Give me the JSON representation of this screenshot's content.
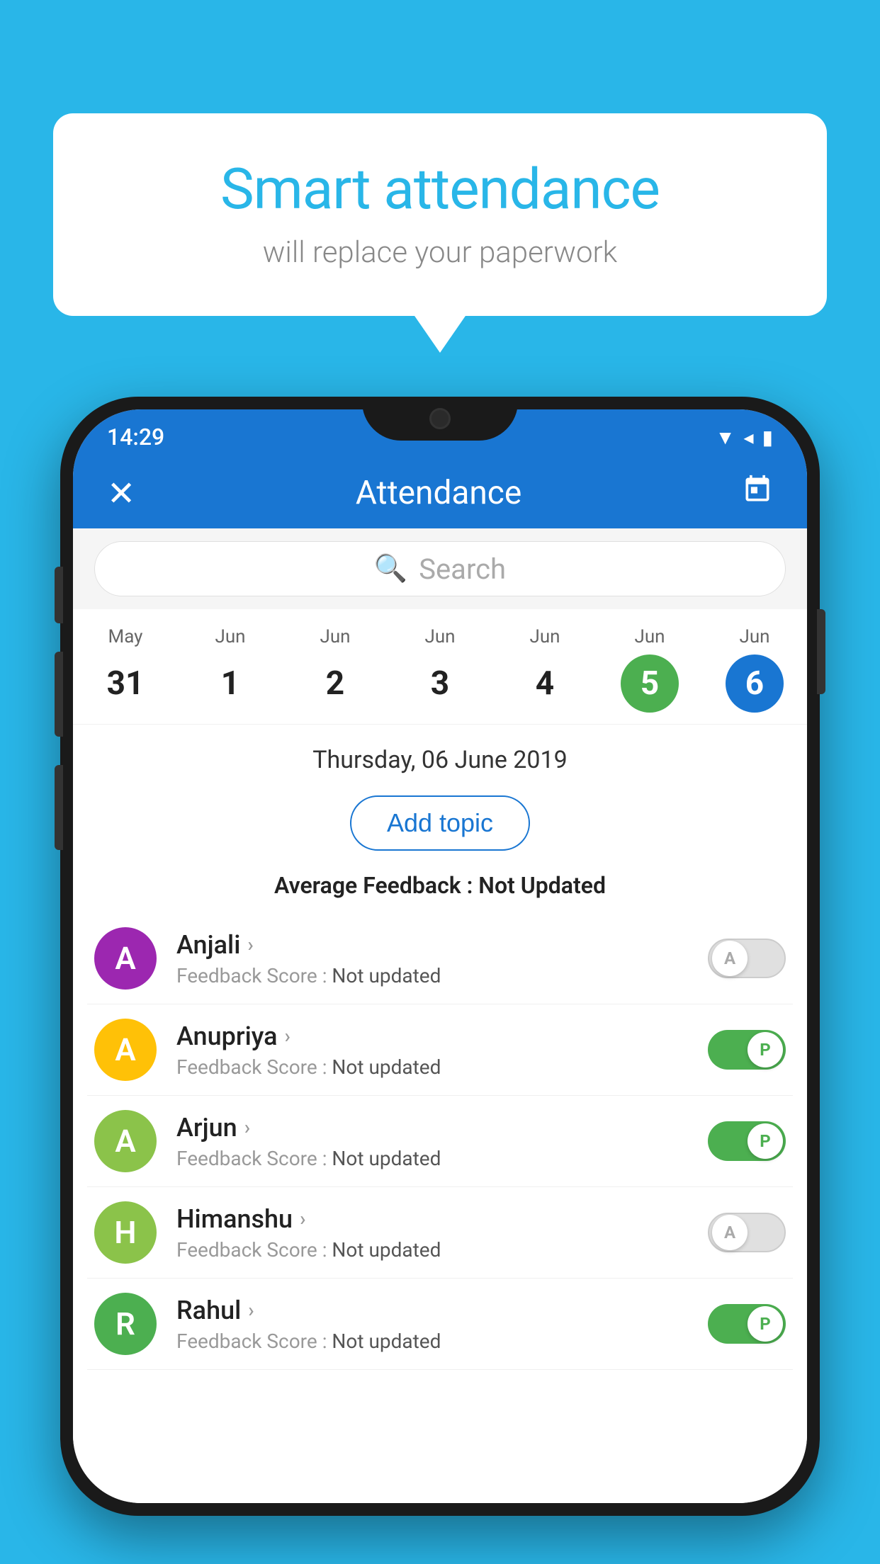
{
  "background_color": "#29B6E8",
  "speech_bubble": {
    "title": "Smart attendance",
    "subtitle": "will replace your paperwork"
  },
  "status_bar": {
    "time": "14:29",
    "wifi_icon": "wifi",
    "signal_icon": "signal",
    "battery_icon": "battery"
  },
  "header": {
    "title": "Attendance",
    "close_label": "✕",
    "calendar_icon": "📅"
  },
  "search": {
    "placeholder": "Search"
  },
  "calendar": {
    "days": [
      {
        "month": "May",
        "date": "31",
        "state": "normal"
      },
      {
        "month": "Jun",
        "date": "1",
        "state": "normal"
      },
      {
        "month": "Jun",
        "date": "2",
        "state": "normal"
      },
      {
        "month": "Jun",
        "date": "3",
        "state": "normal"
      },
      {
        "month": "Jun",
        "date": "4",
        "state": "normal"
      },
      {
        "month": "Jun",
        "date": "5",
        "state": "today"
      },
      {
        "month": "Jun",
        "date": "6",
        "state": "selected"
      }
    ]
  },
  "selected_date": "Thursday, 06 June 2019",
  "add_topic_label": "Add topic",
  "avg_feedback_label": "Average Feedback :",
  "avg_feedback_value": "Not Updated",
  "students": [
    {
      "name": "Anjali",
      "avatar_letter": "A",
      "avatar_color": "#9C27B0",
      "feedback_label": "Feedback Score :",
      "feedback_value": "Not updated",
      "toggle_state": "off",
      "toggle_letter": "A"
    },
    {
      "name": "Anupriya",
      "avatar_letter": "A",
      "avatar_color": "#FFC107",
      "feedback_label": "Feedback Score :",
      "feedback_value": "Not updated",
      "toggle_state": "on",
      "toggle_letter": "P"
    },
    {
      "name": "Arjun",
      "avatar_letter": "A",
      "avatar_color": "#8BC34A",
      "feedback_label": "Feedback Score :",
      "feedback_value": "Not updated",
      "toggle_state": "on",
      "toggle_letter": "P"
    },
    {
      "name": "Himanshu",
      "avatar_letter": "H",
      "avatar_color": "#8BC34A",
      "feedback_label": "Feedback Score :",
      "feedback_value": "Not updated",
      "toggle_state": "off",
      "toggle_letter": "A"
    },
    {
      "name": "Rahul",
      "avatar_letter": "R",
      "avatar_color": "#4CAF50",
      "feedback_label": "Feedback Score :",
      "feedback_value": "Not updated",
      "toggle_state": "on",
      "toggle_letter": "P"
    }
  ]
}
